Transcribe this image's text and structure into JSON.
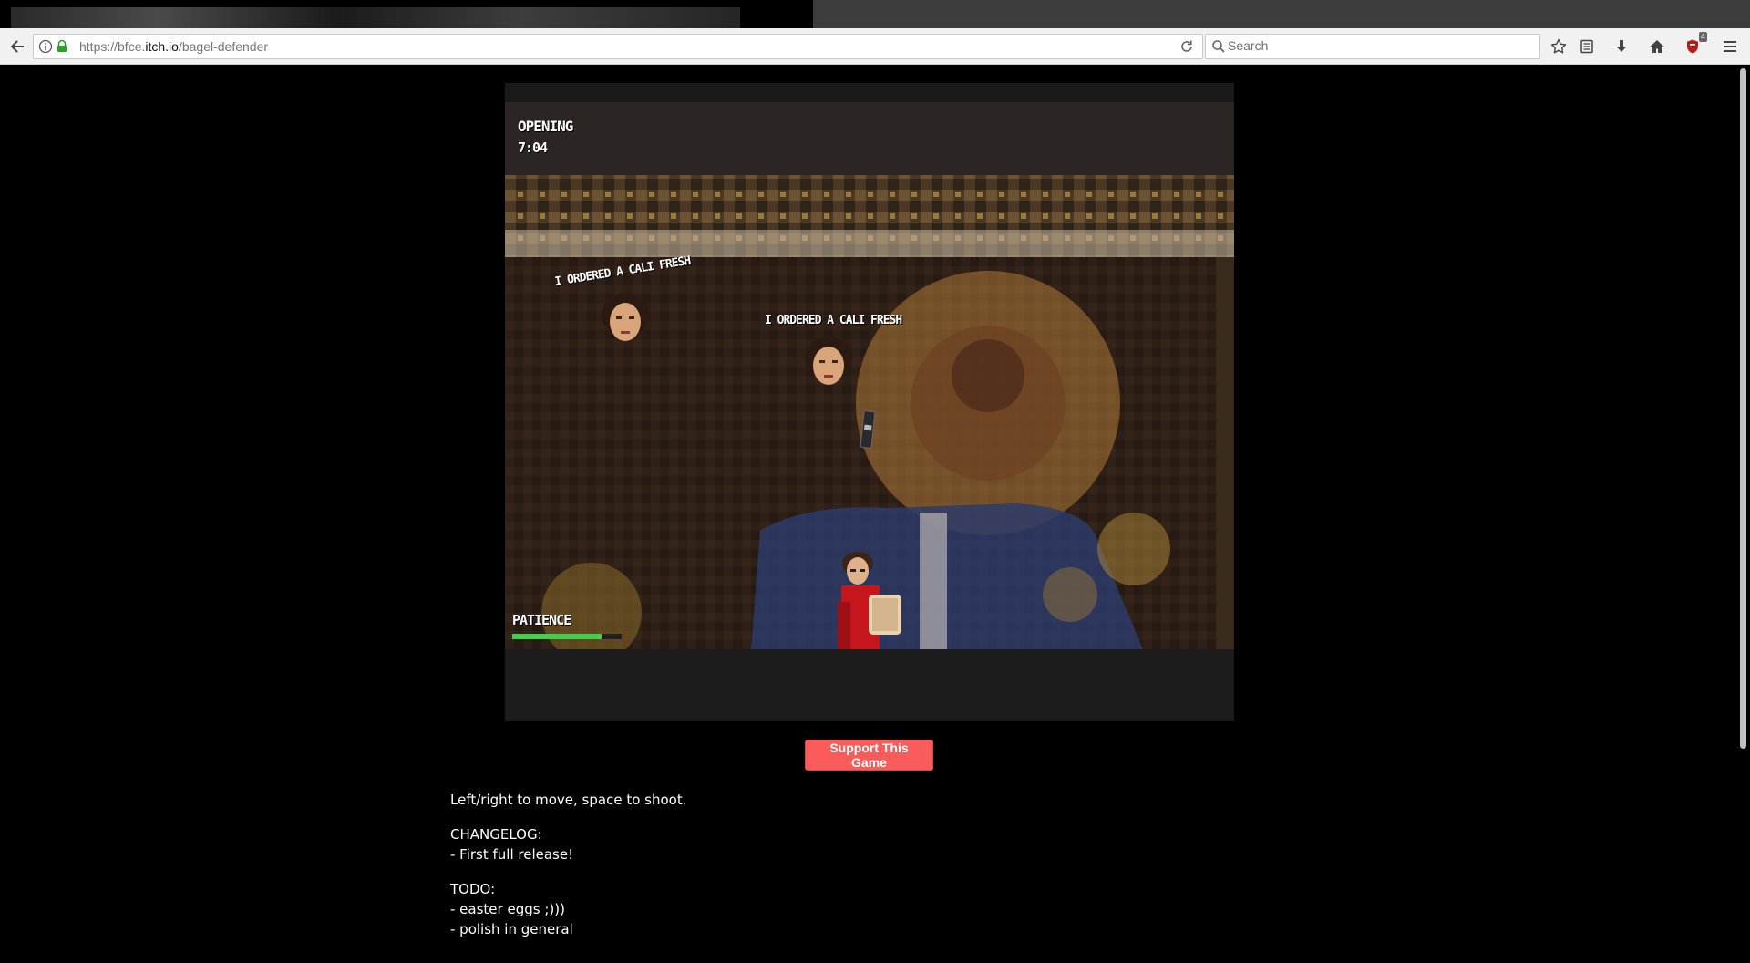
{
  "browser": {
    "url_prefix": "https://bfce.",
    "url_domain": "itch.io",
    "url_path": "/bagel-defender",
    "search_placeholder": "Search",
    "addon_badge": "4"
  },
  "game": {
    "level_label": "OPENING",
    "time": "7:04",
    "speech_bubbles": [
      "I ORDERED A CALI FRESH",
      "I ORDERED A CALI FRESH"
    ],
    "patience_label": "PATIENCE",
    "patience_fraction": 0.82,
    "colors": {
      "patience_bar": "#3cd34a"
    }
  },
  "support_button_label": "Support This Game",
  "description": {
    "controls": "Left/right to move, space to shoot.",
    "changelog_title": "CHANGELOG:",
    "changelog_items": [
      "- First full release!"
    ],
    "todo_title": "TODO:",
    "todo_items": [
      "- easter eggs ;)))",
      "- polish in general"
    ]
  },
  "icons": [
    "back-arrow-icon",
    "info-icon",
    "lock-icon",
    "reload-icon",
    "search-icon",
    "bookmark-star-icon",
    "reading-list-icon",
    "download-icon",
    "home-icon",
    "addon-shield-icon",
    "hamburger-menu-icon"
  ]
}
